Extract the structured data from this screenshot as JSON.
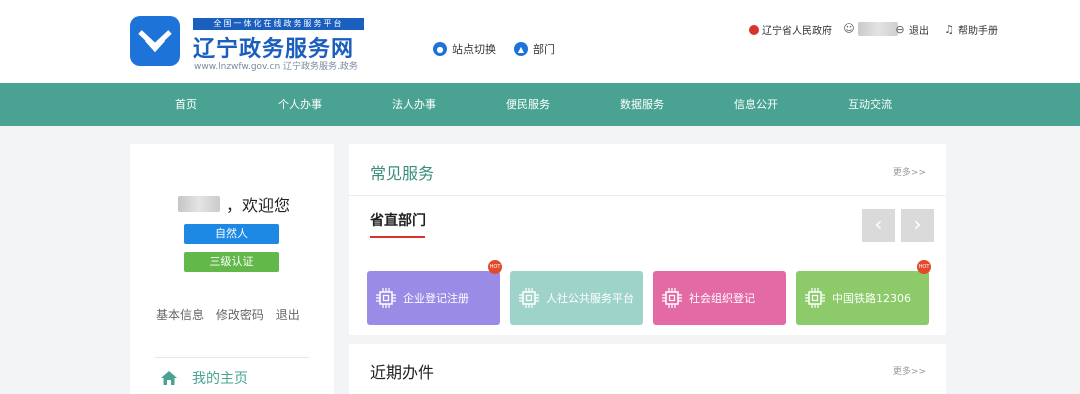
{
  "header": {
    "banner": "全国一体化在线政务服务平台",
    "title": "辽宁政务服务网",
    "url": "www.lnzwfw.gov.cn 辽宁政务服务.政务",
    "site_switch": "站点切换",
    "department": "部门",
    "gov_link": "辽宁省人民政府",
    "logout": "退出",
    "help": "帮助手册"
  },
  "nav": {
    "items": [
      "首页",
      "个人办事",
      "法人办事",
      "便民服务",
      "数据服务",
      "信息公开",
      "互动交流"
    ]
  },
  "left_panel": {
    "welcome": "，欢迎您",
    "badge_person": "自然人",
    "badge_level": "三级认证",
    "links": [
      "基本信息",
      "修改密码",
      "退出"
    ],
    "home": "我的主页"
  },
  "common_services": {
    "title": "常见服务",
    "more": "更多>>",
    "subtitle": "省直部门",
    "tiles": [
      {
        "label": "企业登记注册",
        "color": "#9a8ce6",
        "hot": true
      },
      {
        "label": "人社公共服务平台",
        "color": "#9ed3c9",
        "hot": false
      },
      {
        "label": "社会组织登记",
        "color": "#e46aa5",
        "hot": false
      },
      {
        "label": "中国铁路12306",
        "color": "#8cca6a",
        "hot": true
      }
    ],
    "hot_label": "HOT"
  },
  "recent": {
    "title": "近期办件",
    "more": "更多>>"
  },
  "colors": {
    "brand_blue": "#1b5fbe",
    "nav_teal": "#4aa392",
    "accent_red": "#d8342c"
  }
}
